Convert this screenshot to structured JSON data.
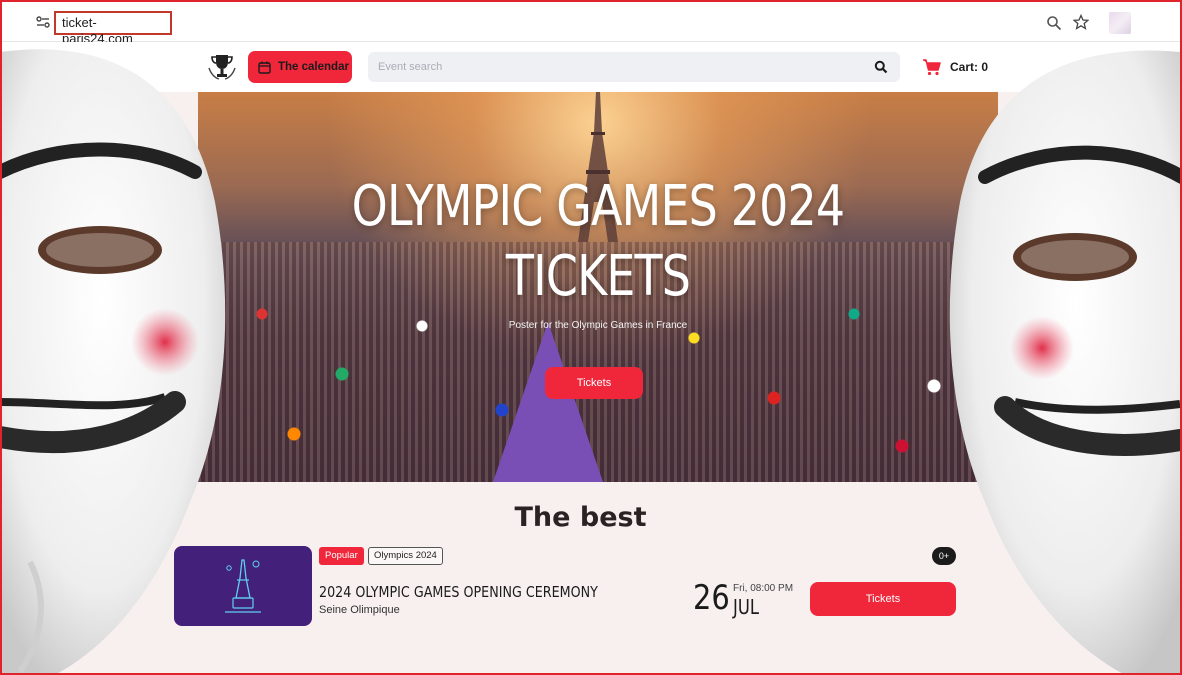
{
  "browser": {
    "url": "ticket-paris24.com",
    "icons": [
      "site-info-icon",
      "zoom-icon",
      "star-icon"
    ]
  },
  "header": {
    "logo": "trophy-icon",
    "calendar_label": "The calendar",
    "search_placeholder": "Event search",
    "cart_label": "Cart:",
    "cart_count": "0"
  },
  "hero": {
    "title_line1": "OLYMPIC GAMES 2024",
    "title_line2": "TICKETS",
    "subtitle": "Poster for the Olympic Games in France",
    "button_label": "Tickets"
  },
  "section": {
    "title": "The best"
  },
  "event": {
    "badge_popular": "Popular",
    "badge_tag": "Olympics 2024",
    "age": "0+",
    "title": "2024 OLYMPIC GAMES OPENING CEREMONY",
    "venue": "Seine Olimpique",
    "day": "26",
    "time": "Fri, 08:00 PM",
    "month": "JUL",
    "button_label": "Tickets"
  },
  "colors": {
    "accent": "#f0263b",
    "frame": "#e0242c",
    "event_image_bg": "#43207a",
    "page_bg": "#f7f0ef"
  }
}
